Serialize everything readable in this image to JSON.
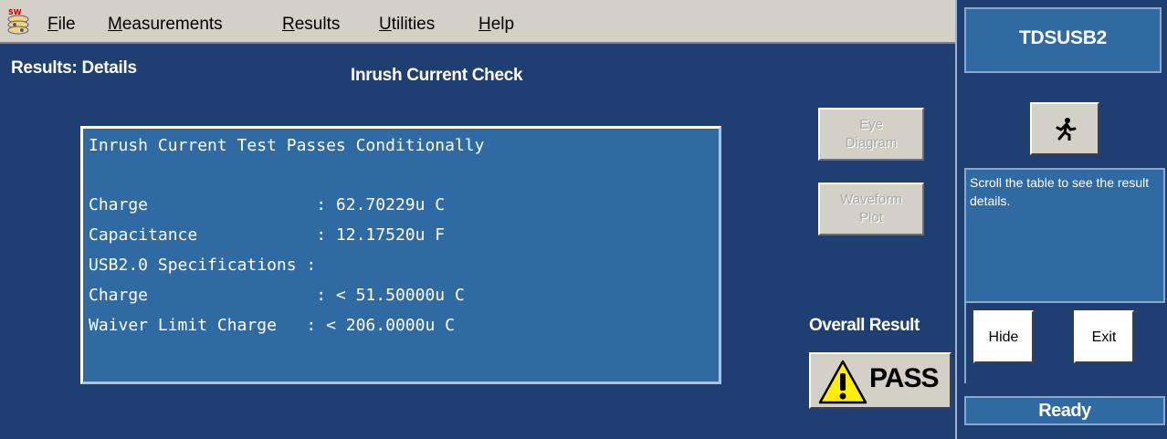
{
  "menu": {
    "items": [
      {
        "underline": "F",
        "rest": "ile"
      },
      {
        "underline": "M",
        "rest": "easurements"
      },
      {
        "underline": "R",
        "rest": "esults"
      },
      {
        "underline": "U",
        "rest": "tilities"
      },
      {
        "underline": "H",
        "rest": "elp"
      }
    ]
  },
  "header": {
    "section": "Results: Details",
    "title": "Inrush Current Check"
  },
  "details": {
    "lines": [
      "Inrush Current Test Passes Conditionally",
      "",
      "Charge                 : 62.70229u C",
      "Capacitance            : 12.17520u F",
      "USB2.0 Specifications :",
      "Charge                 : < 51.50000u C",
      "Waiver Limit Charge   : < 206.0000u C"
    ]
  },
  "buttons": {
    "eye_diagram": [
      "Eye",
      "Diagram"
    ],
    "waveform_plot": [
      "Waveform",
      "Plot"
    ],
    "hide": "Hide",
    "exit": "Exit"
  },
  "result": {
    "label": "Overall Result",
    "value": "PASS"
  },
  "right": {
    "title": "TDSUSB2",
    "help_text": "Scroll the table to see the result details.",
    "status": "Ready"
  },
  "colors": {
    "background": "#1f3f73",
    "panel": "#2f6aa3",
    "button_face": "#d4d0c8",
    "warning": "#ffee00"
  },
  "icons": [
    "app-logo-icon",
    "run-icon",
    "warning-icon"
  ]
}
